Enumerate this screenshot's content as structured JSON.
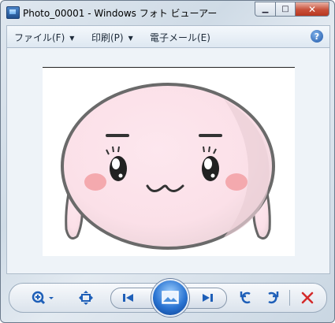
{
  "window": {
    "title": "Photo_00001 - Windows フォト ビューアー"
  },
  "caption_buttons": {
    "minimize": "▁",
    "maximize": "□",
    "close": "✕"
  },
  "menubar": {
    "items": [
      {
        "label": "ファイル(F)",
        "has_dropdown": true
      },
      {
        "label": "印刷(P)",
        "has_dropdown": true
      },
      {
        "label": "電子メール(E)",
        "has_dropdown": false
      }
    ],
    "help": "?"
  },
  "photo": {
    "subject": "pink round cartoon character face"
  },
  "toolbar": {
    "buttons": [
      "zoom-icon",
      "fit-window-icon",
      "previous-icon",
      "slideshow-icon",
      "next-icon",
      "rotate-left-icon",
      "rotate-right-icon",
      "delete-icon"
    ]
  },
  "colors": {
    "close_red": "#c8503a",
    "accent_blue": "#2a74d2",
    "delete_red": "#d42a2a"
  }
}
